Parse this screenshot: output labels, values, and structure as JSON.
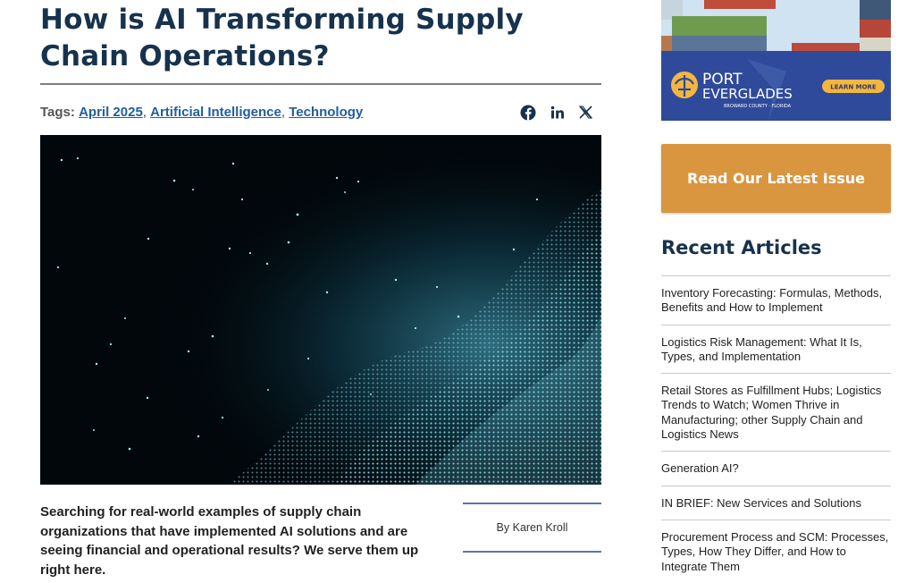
{
  "article": {
    "title": "How is AI Transforming Supply Chain Operations?",
    "tags_label": "Tags:",
    "tags": [
      "April 2025",
      "Artificial Intelligence",
      "Technology"
    ],
    "lede": "Searching for real-world examples of supply chain organizations that have implemented AI solutions and are seeing financial and operational results? We serve them up right here.",
    "byline": "By Karen Kroll"
  },
  "share": {
    "icons": [
      "facebook-icon",
      "linkedin-icon",
      "x-icon"
    ],
    "color": "#17324d"
  },
  "ad": {
    "brand_line1": "PORT",
    "brand_line2": "EVERGLADES",
    "sub": "BROWARD COUNTY · FLORIDA",
    "cta": "LEARN MORE"
  },
  "sidebar": {
    "cta_label": "Read Our Latest Issue",
    "cta_color": "#d9963f",
    "recent_title": "Recent Articles",
    "recent": [
      "Inventory Forecasting: Formulas, Methods, Benefits and How to Implement",
      "Logistics Risk Management: What It Is, Types, and Implementation",
      "Retail Stores as Fulfillment Hubs; Logistics Trends to Watch; Women Thrive in Manufacturing; other Supply Chain and Logistics News",
      "Generation AI?",
      "IN BRIEF: New Services and Solutions",
      "Procurement Process and SCM: Processes, Types, How They Differ, and How to Integrate Them"
    ]
  },
  "colors": {
    "heading": "#17324d",
    "link": "#1f5fa0",
    "rule": "#5877a5"
  }
}
